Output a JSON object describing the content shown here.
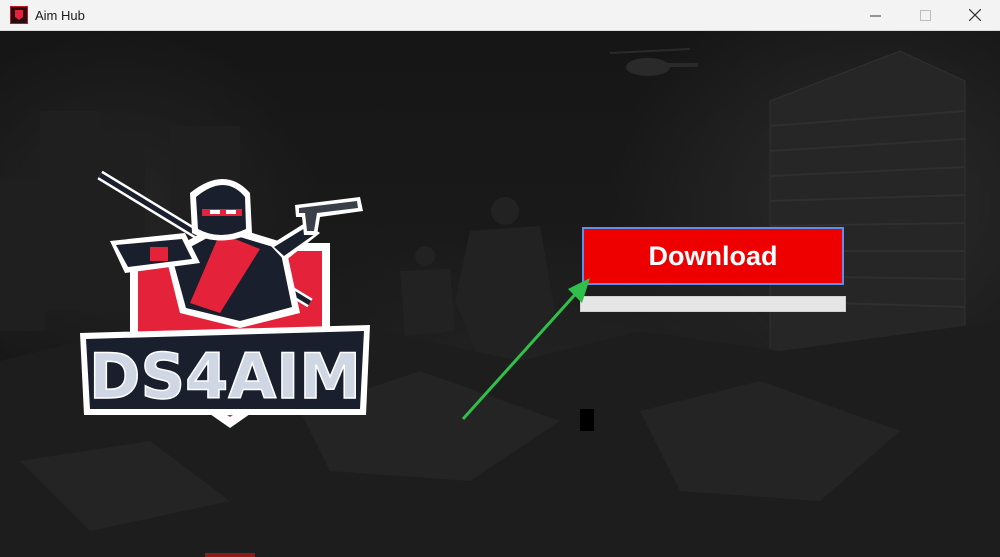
{
  "window": {
    "title": "Aim Hub",
    "icon": "app-logo-icon",
    "controls": {
      "minimize": "—",
      "maximize": "☐",
      "close": "✕"
    }
  },
  "logo": {
    "text": "DS4AIM",
    "colors": {
      "primary_red": "#e4233a",
      "outline": "#ffffff",
      "dark": "#1a1f2e"
    }
  },
  "main": {
    "download_label": "Download",
    "download_color": "#ee0000",
    "progress_percent": 0
  },
  "annotation": {
    "arrow_color": "#2fbf4a",
    "arrow_icon": "green-arrow-icon"
  }
}
